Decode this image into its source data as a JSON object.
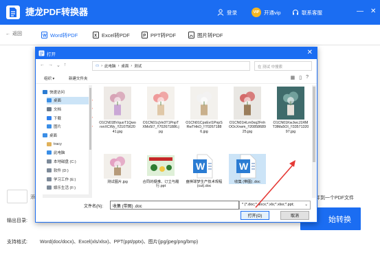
{
  "app": {
    "title": "捷龙PDF转换器",
    "login_label": "登录",
    "vip_badge": "VIP",
    "vip_label": "开通vip",
    "support_label": "联系客服",
    "min_btn": "—",
    "close_btn": "✕",
    "brand_color": "#1b6df2"
  },
  "tabs": {
    "back_label": "返回",
    "items": [
      {
        "label": "Word转PDF",
        "icon": "word-icon",
        "active": true
      },
      {
        "label": "Excel转PDF",
        "icon": "excel-icon",
        "active": false
      },
      {
        "label": "PPT转PDF",
        "icon": "ppt-icon",
        "active": false
      },
      {
        "label": "图片转PDF",
        "icon": "image-icon",
        "active": false
      }
    ]
  },
  "background": {
    "file_btn_text": "添",
    "merge_label": "并到一个PDF文件",
    "output_label": "输出目录:",
    "convert_button": "始转换",
    "formats_label": "支持格式:",
    "formats_text": "Word(doc/docx)、Excel(xls/xlsx)、PPT(ppt/pptx)、图片(jpg/jpeg/png/bmp)"
  },
  "dialog": {
    "title": "打开",
    "close": "✕",
    "breadcrumb": [
      "此电脑",
      "桌面",
      "测试"
    ],
    "search_placeholder": "在 测试 中搜索",
    "organize": "组织 ▾",
    "new_folder": "新建文件夹",
    "sidebar": [
      {
        "label": "快速访问",
        "icon": "star-icon",
        "indent": 0
      },
      {
        "label": "桌面",
        "icon": "desktop-icon",
        "indent": 1,
        "pinned": true,
        "selected": true
      },
      {
        "label": "文档",
        "icon": "doc-folder-icon",
        "indent": 1,
        "pinned": true
      },
      {
        "label": "下载",
        "icon": "download-icon",
        "indent": 1,
        "pinned": true
      },
      {
        "label": "图片",
        "icon": "picture-folder-icon",
        "indent": 1,
        "pinned": true
      },
      {
        "label": "桌面",
        "icon": "desktop-icon",
        "indent": 0
      },
      {
        "label": "tracy",
        "icon": "user-icon",
        "indent": 1
      },
      {
        "label": "此电脑",
        "icon": "computer-icon",
        "indent": 1
      },
      {
        "label": "本地磁盘 (C:)",
        "icon": "drive-icon",
        "indent": 1
      },
      {
        "label": "软件 (D:)",
        "icon": "drive-icon",
        "indent": 1
      },
      {
        "label": "学习工作 (E:)",
        "icon": "drive-icon",
        "indent": 1
      },
      {
        "label": "娱乐生活 (F:)",
        "icon": "drive-icon",
        "indent": 1
      }
    ],
    "files": [
      {
        "name": "O1CN01BVquoT1QworxnXCWy_!!2107562041.jpg",
        "kind": "photo",
        "palette": [
          "#eeeae6",
          "#d7a3b6",
          "#caa7d6"
        ]
      },
      {
        "name": "O1CN01cjVe3T1PnpTXMo5I7_!!702671886.jpg",
        "kind": "photo",
        "palette": [
          "#f4f1ec",
          "#ef9a9a",
          "#e0c8a8"
        ]
      },
      {
        "name": "O1CN01CpsEvI1PnpSRwTHkO_!!702671886.jpg",
        "kind": "photo",
        "palette": [
          "#f3f1ed",
          "#f2f2f2",
          "#c9b08c"
        ]
      },
      {
        "name": "O1CN01HLm0xq2FnhOOcXrwm_!!2085868925.jpg",
        "kind": "photo",
        "palette": [
          "#e9e7e3",
          "#d46a6a",
          "#9a7d5b"
        ]
      },
      {
        "name": "O1CN01KwJwcJ1RMT3lMa5OI_!!3357132097.jpg",
        "kind": "photo",
        "palette": [
          "#3f6b6b",
          "#7aa9a4",
          "#e6e1da"
        ]
      },
      {
        "name": "测试图片.jpg",
        "kind": "photo",
        "palette": [
          "#f2efea",
          "#e3a1c2",
          "#b69a7a"
        ]
      },
      {
        "name": "合同的疑难、订立与履行.ppt",
        "kind": "slide",
        "palette": [
          "#dff0d8",
          "#2e7d32",
          "#c62828"
        ]
      },
      {
        "name": "盘棋球梦生产技术规程(cut).doc",
        "kind": "word",
        "palette": [
          "#2b7cd3",
          "#ffffff",
          "#1e5aa8"
        ]
      },
      {
        "name": "收集 (带图) .doc",
        "kind": "word",
        "palette": [
          "#2b7cd3",
          "#ffffff",
          "#1e5aa8"
        ],
        "selected": true
      }
    ],
    "filename_label": "文件名(N):",
    "filename_value": "收集 (带图) .doc",
    "filter_value": "* (*.doc;*.docx;*.xls;*.xlsx;*.ppt;",
    "open_button": "打开(O)",
    "cancel_button": "取消",
    "annotation_color": "#e53935"
  }
}
